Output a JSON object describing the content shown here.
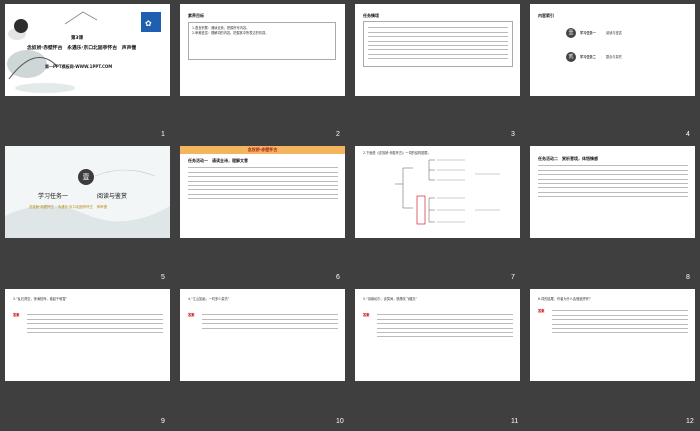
{
  "slides": [
    {
      "num": "1",
      "badge": "第3课",
      "title": "念奴娇·赤壁怀古　永遇乐·京口北固亭怀古　声声慢",
      "subtitle": "第一PPT模板网-WWW.1PPT.COM"
    },
    {
      "num": "2",
      "heading": "素养目标",
      "items": [
        "1.语言积累：诵读全篇，把握所写内容。",
        "2.审美鉴赏：理解词的内容，把握其中所表达的情感。"
      ]
    },
    {
      "num": "3",
      "heading": "任务情境"
    },
    {
      "num": "4",
      "heading": "内容索引",
      "idx": [
        {
          "char": "壹",
          "label": "学习任务一",
          "sub": "阅读与鉴赏"
        },
        {
          "char": "贰",
          "label": "学习任务二",
          "sub": "整合与探究"
        }
      ]
    },
    {
      "num": "5",
      "char": "壹",
      "task": "学习任务一",
      "sub": "阅读与鉴赏",
      "tags": [
        "念奴娇·赤壁怀古",
        "永遇乐·京口北固亭怀古",
        "声声慢"
      ]
    },
    {
      "num": "6",
      "banner": "念奴娇·赤壁怀古",
      "heading": "任务活动一　诵读全诗，理解文意"
    },
    {
      "num": "7",
      "heading": "2.下面是《念奴娇·赤壁怀古》一词的结构图表。"
    },
    {
      "num": "8",
      "heading": "任务活动二　赏析意境，体悟情感"
    },
    {
      "num": "9",
      "heading": "3.“乱石穿空，惊涛拍岸，卷起千堆雪”",
      "answer": "答案"
    },
    {
      "num": "10",
      "heading": "4.“江山如画，一时多少豪杰”",
      "answer": "答案"
    },
    {
      "num": "11",
      "heading": "5.“羽扇纶巾，谈笑间，樯橹灰飞烟灭”",
      "answer": "答案"
    },
    {
      "num": "12",
      "heading": "6.词的结尾，作者为什么会借酒抒怀？",
      "answer": "答案"
    }
  ]
}
